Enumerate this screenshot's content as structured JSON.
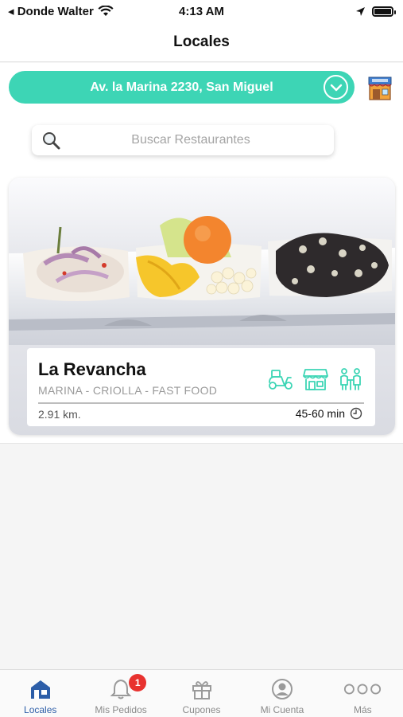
{
  "status_bar": {
    "back_label": "◂ Donde Walter",
    "time": "4:13 AM"
  },
  "nav": {
    "title": "Locales"
  },
  "address": {
    "label": "Av. la Marina 2230, San Miguel"
  },
  "search": {
    "placeholder": "Buscar Restaurantes"
  },
  "restaurants": [
    {
      "name": "La Revancha",
      "categories": "MARINA - CRIOLLA - FAST FOOD",
      "distance": "2.91 km.",
      "eta": "45-60 min",
      "services": [
        "delivery-scooter-icon",
        "storefront-icon",
        "dine-in-people-icon"
      ]
    }
  ],
  "tabs": [
    {
      "label": "Locales",
      "icon": "store-icon",
      "active": true
    },
    {
      "label": "Mis Pedidos",
      "icon": "bell-icon",
      "badge": "1"
    },
    {
      "label": "Cupones",
      "icon": "gift-icon"
    },
    {
      "label": "Mi Cuenta",
      "icon": "user-icon"
    },
    {
      "label": "Más",
      "icon": "more-icon"
    }
  ],
  "colors": {
    "accent": "#3dd5b5",
    "active_tab": "#2d5ea8",
    "badge": "#e8322f"
  }
}
